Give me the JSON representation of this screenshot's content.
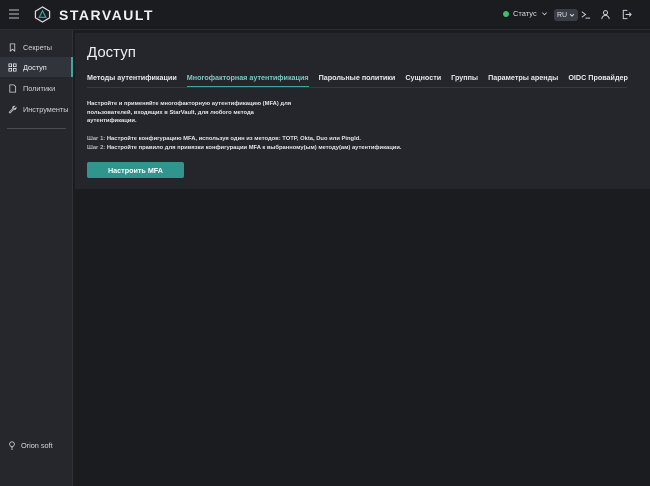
{
  "app": {
    "brand": "STARVAULT"
  },
  "header": {
    "status_label": "Статус",
    "lang": "RU"
  },
  "sidebar": {
    "items": [
      {
        "label": "Секреты",
        "icon": "bookmark-icon"
      },
      {
        "label": "Доступ",
        "icon": "grid-icon"
      },
      {
        "label": "Политики",
        "icon": "document-icon"
      },
      {
        "label": "Инструменты",
        "icon": "wrench-icon"
      }
    ],
    "footer": "Orion soft"
  },
  "main": {
    "title": "Доступ",
    "tabs": [
      {
        "label": "Методы аутентификации"
      },
      {
        "label": "Многофакторная аутентификация"
      },
      {
        "label": "Парольные политики"
      },
      {
        "label": "Сущности"
      },
      {
        "label": "Группы"
      },
      {
        "label": "Параметры аренды"
      },
      {
        "label": "OIDC Провайдер"
      }
    ],
    "description": "Настройте и применяйте многофакторную аутентификацию (MFA) для пользователей, входящих в StarVault, для любого метода аутентификации.",
    "step1_num": "Шаг 1:",
    "step1_text": " Настройте конфигурацию MFA, используя один из методов: TOTP, Okta, Duo или PingId.",
    "step2_num": "Шаг 2:",
    "step2_text": " Настройте правило для привязки конфигурации MFA к выбранному(ым) методу(ам) аутентификации.",
    "button": "Настроить MFA"
  },
  "colors": {
    "accent": "#3aa8a0",
    "status": "#3fbf6a"
  }
}
